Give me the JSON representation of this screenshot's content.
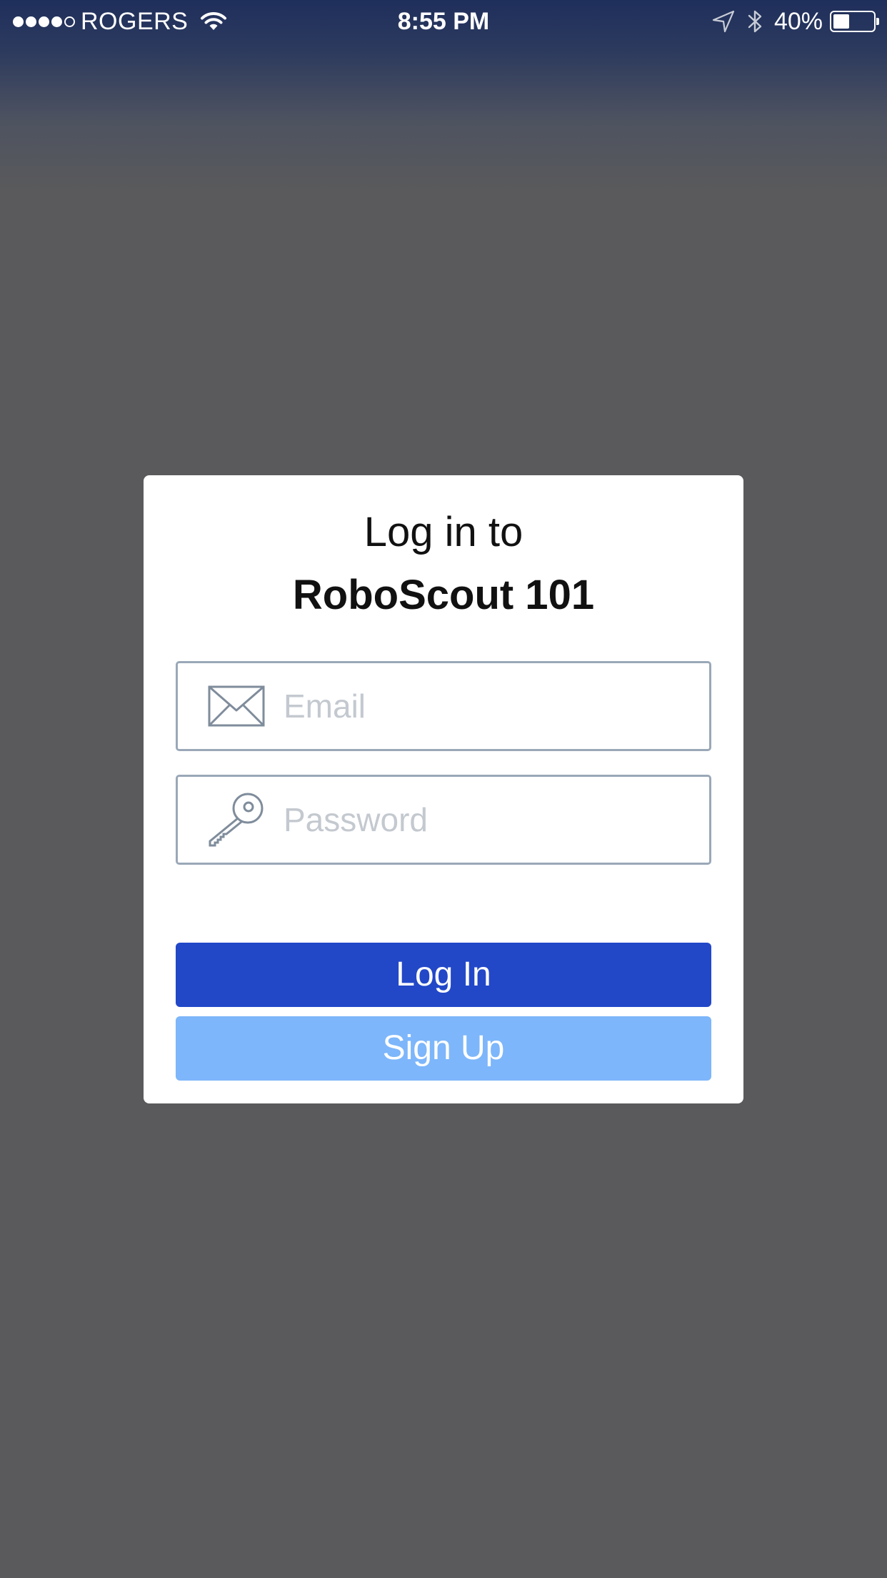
{
  "status_bar": {
    "signal_bars_filled": 4,
    "signal_bars_total": 5,
    "carrier": "ROGERS",
    "time": "8:55 PM",
    "battery_percent_label": "40%",
    "battery_level": 0.4
  },
  "login_dialog": {
    "title_line1": "Log in to",
    "title_line2": "RoboScout 101",
    "email": {
      "placeholder": "Email",
      "value": "",
      "icon": "envelope-icon"
    },
    "password": {
      "placeholder": "Password",
      "value": "",
      "icon": "key-icon"
    },
    "login_button_label": "Log In",
    "signup_button_label": "Sign Up"
  },
  "colors": {
    "status_bar_top": "#1f2f5c",
    "backdrop": "#5a5a5c",
    "dialog_bg": "#ffffff",
    "login_button": "#2248c8",
    "signup_button": "#7db6fa",
    "field_border": "#9aa8b8",
    "placeholder": "#c4c9d0",
    "icon_stroke": "#7f8c9b"
  }
}
